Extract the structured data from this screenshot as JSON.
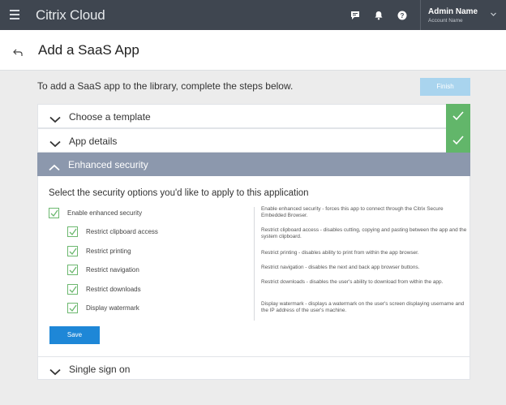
{
  "topbar": {
    "brand": "Citrix Cloud",
    "account_name": "Admin Name",
    "account_sub": "Account Name"
  },
  "header": {
    "title": "Add a SaaS App"
  },
  "intro": {
    "text": "To add a SaaS app to the library, complete the steps below.",
    "finish_label": "Finish"
  },
  "steps": [
    {
      "label": "Choose a template",
      "completed": true
    },
    {
      "label": "App details",
      "completed": true
    },
    {
      "label": "Enhanced security",
      "expanded": true
    },
    {
      "label": "Single sign on"
    }
  ],
  "security": {
    "question": "Select the security options you'd like to apply to this application",
    "options": [
      {
        "label": "Enable enhanced security",
        "checked": true
      },
      {
        "label": "Restrict clipboard access",
        "checked": true
      },
      {
        "label": "Restrict printing",
        "checked": true
      },
      {
        "label": "Restrict navigation",
        "checked": true
      },
      {
        "label": "Restrict downloads",
        "checked": true
      },
      {
        "label": "Display watermark",
        "checked": true
      }
    ],
    "save_label": "Save",
    "descriptions": [
      "Enable enhanced security - forces this app to connect through the Citrix Secure Embedded Browser.",
      "Restrict clipboard access - disables cutting, copying and pasting between the app and the system clipboard.",
      "Restrict printing - disables ability to print from within the app browser.",
      "Restrict navigation - disables the next and back app browser buttons.",
      "Restrict downloads - disables the user's ability to download from within the app.",
      "Display watermark - displays a watermark on the user's screen displaying username and the IP address of the user's machine."
    ]
  },
  "colors": {
    "topbar": "#3f4650",
    "check_green": "#62b66a",
    "section_header": "#8c98ad",
    "primary_button": "#1e87d7",
    "disabled_button": "#a9d4ee"
  }
}
